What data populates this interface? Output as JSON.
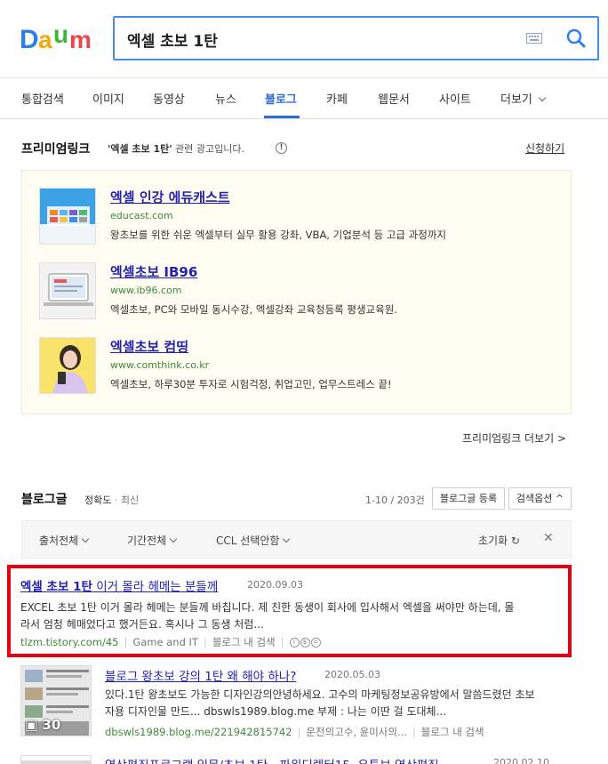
{
  "header": {
    "logo_letters": [
      "D",
      "a",
      "u",
      "m"
    ],
    "search": {
      "value": "엑셀 초보 1탄"
    }
  },
  "tabs": [
    {
      "label": "통합검색"
    },
    {
      "label": "이미지"
    },
    {
      "label": "동영상"
    },
    {
      "label": "뉴스"
    },
    {
      "label": "블로그",
      "active": true
    },
    {
      "label": "카페"
    },
    {
      "label": "웹문서"
    },
    {
      "label": "사이트"
    },
    {
      "label": "더보기"
    }
  ],
  "premium": {
    "title": "프리미엄링크",
    "desc_query": "'엑셀 초보 1탄'",
    "desc_suffix": " 관련 광고입니다.",
    "apply_label": "신청하기",
    "more_label": "프리미엄링크 더보기 >",
    "ads": [
      {
        "title": "엑셀 인강 에듀캐스트",
        "url": "educast.com",
        "desc": "왕초보를 위한 쉬운 엑셀부터 실무 활용 강좌, VBA, 기업분석 등 고급 과정까지"
      },
      {
        "title": "엑셀초보 IB96",
        "url": "www.ib96.com",
        "desc": "엑셀초보, PC와 모바일 동시수강, 엑셀강좌 교육청등록 평생교육원."
      },
      {
        "title": "엑셀초보 컴띵",
        "url": "www.comthink.co.kr",
        "desc": "엑셀초보, 하루30분 투자로 시험걱정, 취업고민, 업무스트레스 끝!"
      }
    ]
  },
  "blog": {
    "title": "블로그글",
    "sort_accuracy": "정확도",
    "sort_dot": "·",
    "sort_latest": "최신",
    "count": "1-10 / 203건",
    "register_label": "블로그글 등록",
    "options_label": "검색옵션 ^",
    "filters": {
      "source": "출처전체",
      "period": "기간전체",
      "ccl": "CCL 선택안함",
      "reset": "초기화 ↻",
      "close": "✕"
    },
    "results": [
      {
        "title_bold": "엑셀 초보 1탄",
        "title_rest": " 이거 몰라 헤메는 분들께",
        "date": "2020.09.03",
        "desc_line1": "EXCEL 초보 1탄 이거 몰라 헤메는 분들께 바칩니다. 제 친한 동생이 회사에 입사해서 엑셀을 써야만 하는데, 몰",
        "desc_line2": "라서 엄청 헤매었다고 했거든요. 혹시나 그 동생 처럼...",
        "url": "tlzm.tistory.com/45",
        "category": "Game and IT",
        "inner_search": "블로그 내 검색",
        "ccl": [
          "i",
          "$",
          "="
        ]
      },
      {
        "title": "블로그 왕초보 강의 1탄 왜 해야 하나?",
        "date": "2020.05.03",
        "desc_line1": "있다.1탄 왕초보도 가능한 디자인강의안녕하세요. 고수의 마케팅정보공유방에서 말씀드렸던 초보",
        "desc_line2": "자용 디자인물 만드... dbswls1989.blog.me 부제 : 나는 이딴 걸 도대체...",
        "url": "dbswls1989.blog.me/221942815742",
        "category": "운전의고수, 윤미사의...",
        "inner_search": "블로그 내 검색",
        "photo_count": "30"
      },
      {
        "title": "영상편집프로그램 입문/초보 1탄 - 파워디렉터15, 유튜브 영상편집",
        "date": "2020.02.10"
      }
    ]
  }
}
